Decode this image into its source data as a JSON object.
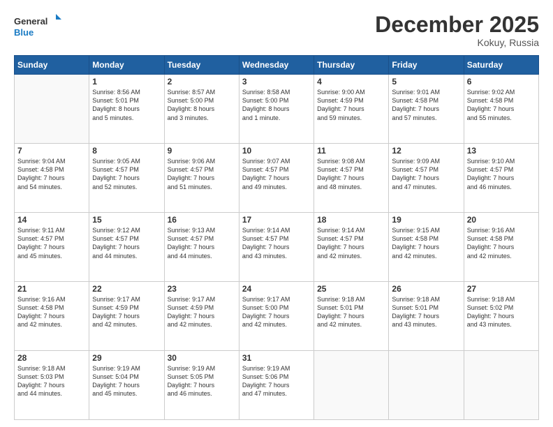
{
  "logo": {
    "line1": "General",
    "line2": "Blue"
  },
  "title": "December 2025",
  "location": "Kokuy, Russia",
  "days_header": [
    "Sunday",
    "Monday",
    "Tuesday",
    "Wednesday",
    "Thursday",
    "Friday",
    "Saturday"
  ],
  "weeks": [
    [
      {
        "num": "",
        "info": ""
      },
      {
        "num": "1",
        "info": "Sunrise: 8:56 AM\nSunset: 5:01 PM\nDaylight: 8 hours\nand 5 minutes."
      },
      {
        "num": "2",
        "info": "Sunrise: 8:57 AM\nSunset: 5:00 PM\nDaylight: 8 hours\nand 3 minutes."
      },
      {
        "num": "3",
        "info": "Sunrise: 8:58 AM\nSunset: 5:00 PM\nDaylight: 8 hours\nand 1 minute."
      },
      {
        "num": "4",
        "info": "Sunrise: 9:00 AM\nSunset: 4:59 PM\nDaylight: 7 hours\nand 59 minutes."
      },
      {
        "num": "5",
        "info": "Sunrise: 9:01 AM\nSunset: 4:58 PM\nDaylight: 7 hours\nand 57 minutes."
      },
      {
        "num": "6",
        "info": "Sunrise: 9:02 AM\nSunset: 4:58 PM\nDaylight: 7 hours\nand 55 minutes."
      }
    ],
    [
      {
        "num": "7",
        "info": "Sunrise: 9:04 AM\nSunset: 4:58 PM\nDaylight: 7 hours\nand 54 minutes."
      },
      {
        "num": "8",
        "info": "Sunrise: 9:05 AM\nSunset: 4:57 PM\nDaylight: 7 hours\nand 52 minutes."
      },
      {
        "num": "9",
        "info": "Sunrise: 9:06 AM\nSunset: 4:57 PM\nDaylight: 7 hours\nand 51 minutes."
      },
      {
        "num": "10",
        "info": "Sunrise: 9:07 AM\nSunset: 4:57 PM\nDaylight: 7 hours\nand 49 minutes."
      },
      {
        "num": "11",
        "info": "Sunrise: 9:08 AM\nSunset: 4:57 PM\nDaylight: 7 hours\nand 48 minutes."
      },
      {
        "num": "12",
        "info": "Sunrise: 9:09 AM\nSunset: 4:57 PM\nDaylight: 7 hours\nand 47 minutes."
      },
      {
        "num": "13",
        "info": "Sunrise: 9:10 AM\nSunset: 4:57 PM\nDaylight: 7 hours\nand 46 minutes."
      }
    ],
    [
      {
        "num": "14",
        "info": "Sunrise: 9:11 AM\nSunset: 4:57 PM\nDaylight: 7 hours\nand 45 minutes."
      },
      {
        "num": "15",
        "info": "Sunrise: 9:12 AM\nSunset: 4:57 PM\nDaylight: 7 hours\nand 44 minutes."
      },
      {
        "num": "16",
        "info": "Sunrise: 9:13 AM\nSunset: 4:57 PM\nDaylight: 7 hours\nand 44 minutes."
      },
      {
        "num": "17",
        "info": "Sunrise: 9:14 AM\nSunset: 4:57 PM\nDaylight: 7 hours\nand 43 minutes."
      },
      {
        "num": "18",
        "info": "Sunrise: 9:14 AM\nSunset: 4:57 PM\nDaylight: 7 hours\nand 42 minutes."
      },
      {
        "num": "19",
        "info": "Sunrise: 9:15 AM\nSunset: 4:58 PM\nDaylight: 7 hours\nand 42 minutes."
      },
      {
        "num": "20",
        "info": "Sunrise: 9:16 AM\nSunset: 4:58 PM\nDaylight: 7 hours\nand 42 minutes."
      }
    ],
    [
      {
        "num": "21",
        "info": "Sunrise: 9:16 AM\nSunset: 4:58 PM\nDaylight: 7 hours\nand 42 minutes."
      },
      {
        "num": "22",
        "info": "Sunrise: 9:17 AM\nSunset: 4:59 PM\nDaylight: 7 hours\nand 42 minutes."
      },
      {
        "num": "23",
        "info": "Sunrise: 9:17 AM\nSunset: 4:59 PM\nDaylight: 7 hours\nand 42 minutes."
      },
      {
        "num": "24",
        "info": "Sunrise: 9:17 AM\nSunset: 5:00 PM\nDaylight: 7 hours\nand 42 minutes."
      },
      {
        "num": "25",
        "info": "Sunrise: 9:18 AM\nSunset: 5:01 PM\nDaylight: 7 hours\nand 42 minutes."
      },
      {
        "num": "26",
        "info": "Sunrise: 9:18 AM\nSunset: 5:01 PM\nDaylight: 7 hours\nand 43 minutes."
      },
      {
        "num": "27",
        "info": "Sunrise: 9:18 AM\nSunset: 5:02 PM\nDaylight: 7 hours\nand 43 minutes."
      }
    ],
    [
      {
        "num": "28",
        "info": "Sunrise: 9:18 AM\nSunset: 5:03 PM\nDaylight: 7 hours\nand 44 minutes."
      },
      {
        "num": "29",
        "info": "Sunrise: 9:19 AM\nSunset: 5:04 PM\nDaylight: 7 hours\nand 45 minutes."
      },
      {
        "num": "30",
        "info": "Sunrise: 9:19 AM\nSunset: 5:05 PM\nDaylight: 7 hours\nand 46 minutes."
      },
      {
        "num": "31",
        "info": "Sunrise: 9:19 AM\nSunset: 5:06 PM\nDaylight: 7 hours\nand 47 minutes."
      },
      {
        "num": "",
        "info": ""
      },
      {
        "num": "",
        "info": ""
      },
      {
        "num": "",
        "info": ""
      }
    ]
  ]
}
